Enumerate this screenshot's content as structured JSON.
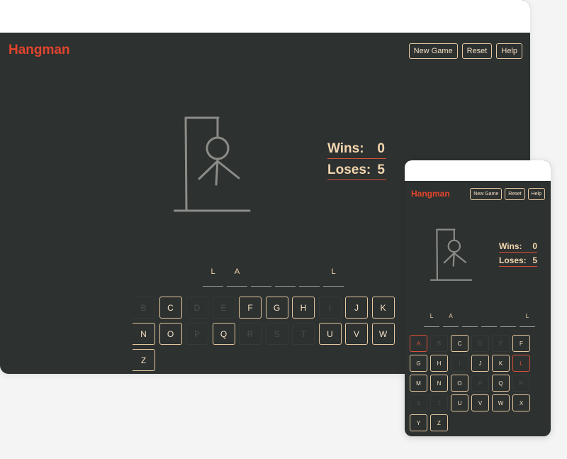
{
  "app": {
    "title": "Hangman"
  },
  "buttons": {
    "new_game": "New Game",
    "reset": "Reset",
    "help": "Help"
  },
  "score": {
    "wins_label": "Wins:",
    "wins": "0",
    "loses_label": "Loses:",
    "loses": "5"
  },
  "word_slots": [
    "L",
    "A",
    "",
    "",
    "",
    "L"
  ],
  "desktop": {
    "keys": [
      {
        "letter": "B",
        "state": "used"
      },
      {
        "letter": "C",
        "state": "available"
      },
      {
        "letter": "D",
        "state": "used"
      },
      {
        "letter": "E",
        "state": "used"
      },
      {
        "letter": "F",
        "state": "available"
      },
      {
        "letter": "G",
        "state": "available"
      },
      {
        "letter": "H",
        "state": "available"
      },
      {
        "letter": "I",
        "state": "used"
      },
      {
        "letter": "J",
        "state": "available"
      },
      {
        "letter": "K",
        "state": "available"
      },
      {
        "letter": "N",
        "state": "available"
      },
      {
        "letter": "O",
        "state": "available"
      },
      {
        "letter": "P",
        "state": "used"
      },
      {
        "letter": "Q",
        "state": "available"
      },
      {
        "letter": "R",
        "state": "used"
      },
      {
        "letter": "S",
        "state": "used"
      },
      {
        "letter": "T",
        "state": "used"
      },
      {
        "letter": "U",
        "state": "available"
      },
      {
        "letter": "V",
        "state": "available"
      },
      {
        "letter": "W",
        "state": "available"
      },
      {
        "letter": "Z",
        "state": "available"
      }
    ]
  },
  "mobile": {
    "keys": [
      {
        "letter": "A",
        "state": "wrong"
      },
      {
        "letter": "B",
        "state": "used"
      },
      {
        "letter": "C",
        "state": "available"
      },
      {
        "letter": "D",
        "state": "used"
      },
      {
        "letter": "E",
        "state": "used"
      },
      {
        "letter": "F",
        "state": "available"
      },
      {
        "letter": "G",
        "state": "available"
      },
      {
        "letter": "H",
        "state": "available"
      },
      {
        "letter": "I",
        "state": "used"
      },
      {
        "letter": "J",
        "state": "available"
      },
      {
        "letter": "K",
        "state": "available"
      },
      {
        "letter": "L",
        "state": "wrong"
      },
      {
        "letter": "M",
        "state": "available"
      },
      {
        "letter": "N",
        "state": "available"
      },
      {
        "letter": "O",
        "state": "available"
      },
      {
        "letter": "P",
        "state": "used"
      },
      {
        "letter": "Q",
        "state": "available"
      },
      {
        "letter": "R",
        "state": "used"
      },
      {
        "letter": "S",
        "state": "used"
      },
      {
        "letter": "T",
        "state": "used"
      },
      {
        "letter": "U",
        "state": "available"
      },
      {
        "letter": "V",
        "state": "available"
      },
      {
        "letter": "W",
        "state": "available"
      },
      {
        "letter": "X",
        "state": "available"
      },
      {
        "letter": "Y",
        "state": "available"
      },
      {
        "letter": "Z",
        "state": "available"
      }
    ]
  },
  "colors": {
    "background": "#2d3130",
    "title": "#e2452d",
    "accent_border": "#e6c9a1",
    "text": "#f4d6b0",
    "wrong": "#d9503a"
  }
}
